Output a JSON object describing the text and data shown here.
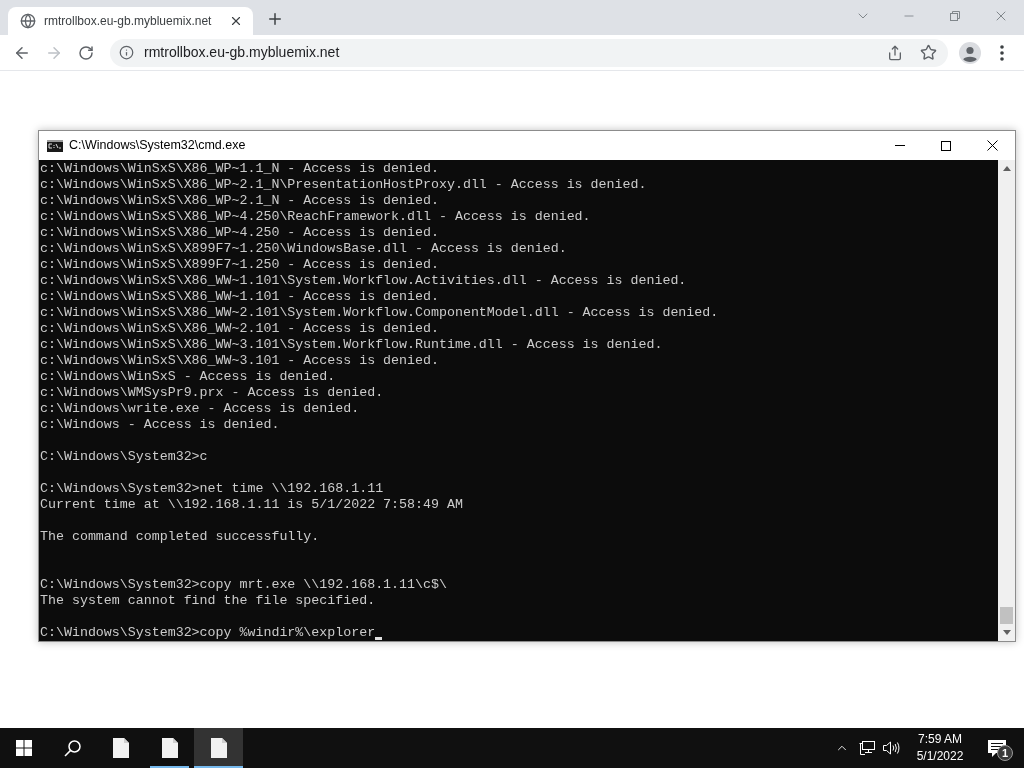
{
  "browser": {
    "tabs": [
      {
        "title": "rmtrollbox.eu-gb.mybluemix.net",
        "selected": true
      }
    ],
    "navigation": {
      "back_disabled": false,
      "forward_disabled": true
    },
    "address_bar": {
      "url": "rmtrollbox.eu-gb.mybluemix.net"
    }
  },
  "console_window": {
    "title": "C:\\Windows\\System32\\cmd.exe",
    "lines": [
      {
        "kind": "text",
        "text": "c:\\Windows\\WinSxS\\X86_WP~1.1_N - Access is denied."
      },
      {
        "kind": "text",
        "text": "c:\\Windows\\WinSxS\\X86_WP~2.1_N\\PresentationHostProxy.dll - Access is denied."
      },
      {
        "kind": "text",
        "text": "c:\\Windows\\WinSxS\\X86_WP~2.1_N - Access is denied."
      },
      {
        "kind": "text",
        "text": "c:\\Windows\\WinSxS\\X86_WP~4.250\\ReachFramework.dll - Access is denied."
      },
      {
        "kind": "text",
        "text": "c:\\Windows\\WinSxS\\X86_WP~4.250 - Access is denied."
      },
      {
        "kind": "text",
        "text": "c:\\Windows\\WinSxS\\X899F7~1.250\\WindowsBase.dll - Access is denied."
      },
      {
        "kind": "text",
        "text": "c:\\Windows\\WinSxS\\X899F7~1.250 - Access is denied."
      },
      {
        "kind": "text",
        "text": "c:\\Windows\\WinSxS\\X86_WW~1.101\\System.Workflow.Activities.dll - Access is denied."
      },
      {
        "kind": "text",
        "text": "c:\\Windows\\WinSxS\\X86_WW~1.101 - Access is denied."
      },
      {
        "kind": "text",
        "text": "c:\\Windows\\WinSxS\\X86_WW~2.101\\System.Workflow.ComponentModel.dll - Access is denied."
      },
      {
        "kind": "text",
        "text": "c:\\Windows\\WinSxS\\X86_WW~2.101 - Access is denied."
      },
      {
        "kind": "text",
        "text": "c:\\Windows\\WinSxS\\X86_WW~3.101\\System.Workflow.Runtime.dll - Access is denied."
      },
      {
        "kind": "text",
        "text": "c:\\Windows\\WinSxS\\X86_WW~3.101 - Access is denied."
      },
      {
        "kind": "text",
        "text": "c:\\Windows\\WinSxS - Access is denied."
      },
      {
        "kind": "text",
        "text": "c:\\Windows\\WMSysPr9.prx - Access is denied."
      },
      {
        "kind": "text",
        "text": "c:\\Windows\\write.exe - Access is denied."
      },
      {
        "kind": "text",
        "text": "c:\\Windows - Access is denied."
      },
      {
        "kind": "blank"
      },
      {
        "kind": "text",
        "text": "C:\\Windows\\System32>c"
      },
      {
        "kind": "blank"
      },
      {
        "kind": "text",
        "text": "C:\\Windows\\System32>net time \\\\192.168.1.11"
      },
      {
        "kind": "text",
        "text": "Current time at \\\\192.168.1.11 is 5/1/2022 7:58:49 AM"
      },
      {
        "kind": "blank"
      },
      {
        "kind": "text",
        "text": "The command completed successfully."
      },
      {
        "kind": "blank"
      },
      {
        "kind": "blank"
      },
      {
        "kind": "text",
        "text": "C:\\Windows\\System32>copy mrt.exe \\\\192.168.1.11\\c$\\"
      },
      {
        "kind": "text",
        "text": "The system cannot find the file specified."
      },
      {
        "kind": "blank"
      }
    ],
    "input": {
      "text": "C:\\Windows\\System32>copy %windir%\\explorer",
      "cursor": true
    }
  },
  "taskbar": {
    "apps": [
      {
        "running": false,
        "active": false
      },
      {
        "running": true,
        "active": false
      },
      {
        "running": true,
        "active": true
      }
    ],
    "clock": {
      "time": "7:59 AM",
      "date": "5/1/2022"
    },
    "notifications": {
      "count": "1"
    }
  }
}
